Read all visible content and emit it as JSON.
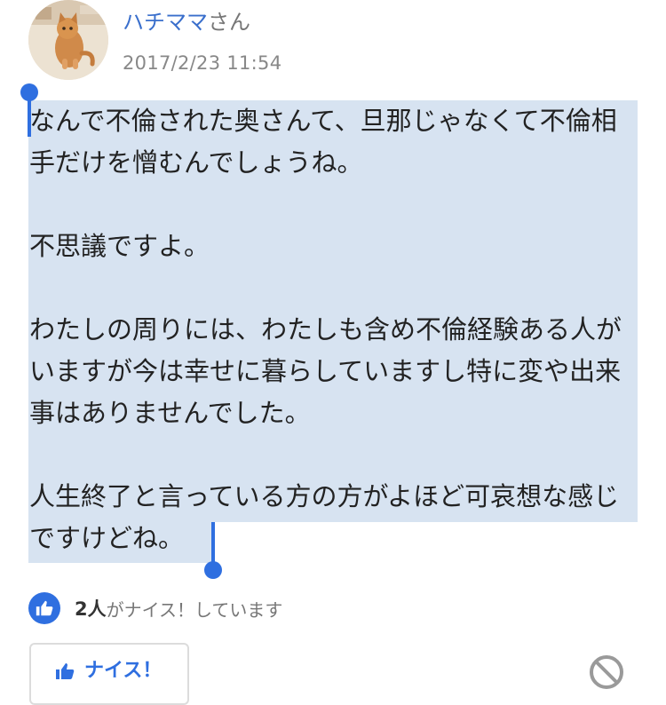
{
  "post": {
    "author_name": "ハチママ",
    "author_suffix": "さん",
    "timestamp": "2017/2/23 11:54",
    "body_paragraphs": [
      "なんで不倫された奥さんて、旦那じゃなくて不倫相手だけを憎むんでしょうね。",
      "不思議ですよ。",
      "わたしの周りには、わたしも含め不倫経験ある人がいますが今は幸せに暮らしていますし特に変や出来事はありませんでした。",
      "人生終了と言っている方の方がよほど可哀想な感じですけどね。"
    ]
  },
  "reactions": {
    "nice_count": "2人",
    "nice_text": "がナイス！しています",
    "nice_button_label": "ナイス！"
  },
  "icons": {
    "avatar": "cat-photo",
    "nice_badge": "thumbs-up-icon",
    "nice_button": "thumbs-up-icon",
    "report": "prohibited-icon"
  },
  "colors": {
    "accent": "#2f6fe0",
    "selection": "#d7e3f1",
    "author_link": "#3a6fcc"
  }
}
